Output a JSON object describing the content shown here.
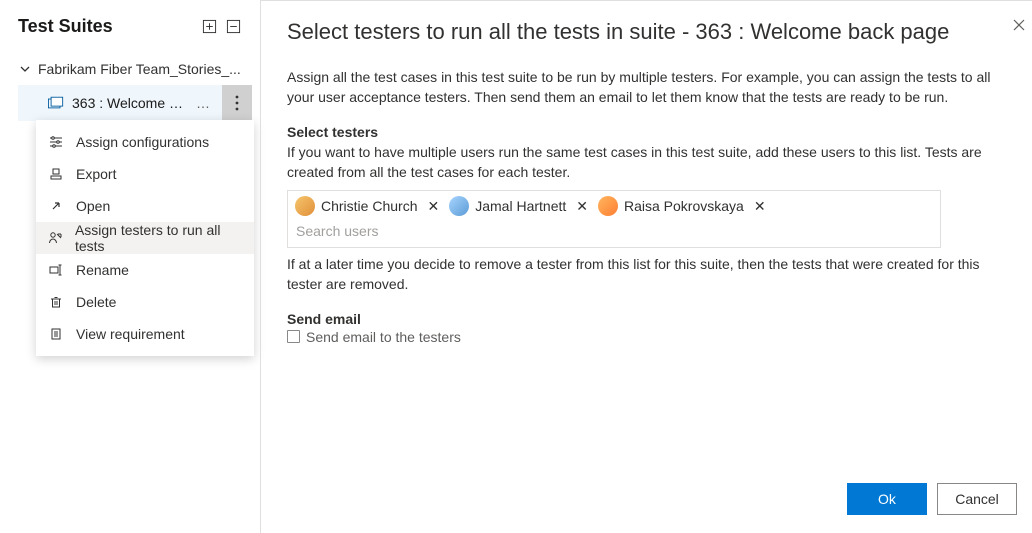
{
  "sidebar": {
    "title": "Test Suites",
    "root_label": "Fabrikam Fiber Team_Stories_...",
    "selected_suite_label": "363 : Welcome back..."
  },
  "context_menu": {
    "items": [
      {
        "label": "Assign configurations"
      },
      {
        "label": "Export"
      },
      {
        "label": "Open"
      },
      {
        "label": "Assign testers to run all tests"
      },
      {
        "label": "Rename"
      },
      {
        "label": "Delete"
      },
      {
        "label": "View requirement"
      }
    ],
    "active_index": 3
  },
  "dialog": {
    "title": "Select testers to run all the tests in suite - 363 : Welcome back page",
    "intro": "Assign all the test cases in this test suite to be run by multiple testers. For example, you can assign the tests to all your user acceptance testers. Then send them an email to let them know that the tests are ready to be run.",
    "select_heading": "Select testers",
    "select_hint": "If you want to have multiple users run the same test cases in this test suite, add these users to this list. Tests are created from all the test cases for each tester.",
    "testers": [
      {
        "name": "Christie Church",
        "avatar_bg": "linear-gradient(135deg,#f6c56b,#e08f3a)"
      },
      {
        "name": "Jamal Hartnett",
        "avatar_bg": "linear-gradient(135deg,#a8d5ff,#5b9bd5)"
      },
      {
        "name": "Raisa Pokrovskaya",
        "avatar_bg": "linear-gradient(135deg,#ffb65e,#ff7e33)"
      }
    ],
    "search_placeholder": "Search users",
    "removal_hint": "If at a later time you decide to remove a tester from this list for this suite, then the tests that were created for this tester are removed.",
    "send_heading": "Send email",
    "send_checkbox_label": "Send email to the testers",
    "ok_label": "Ok",
    "cancel_label": "Cancel"
  }
}
